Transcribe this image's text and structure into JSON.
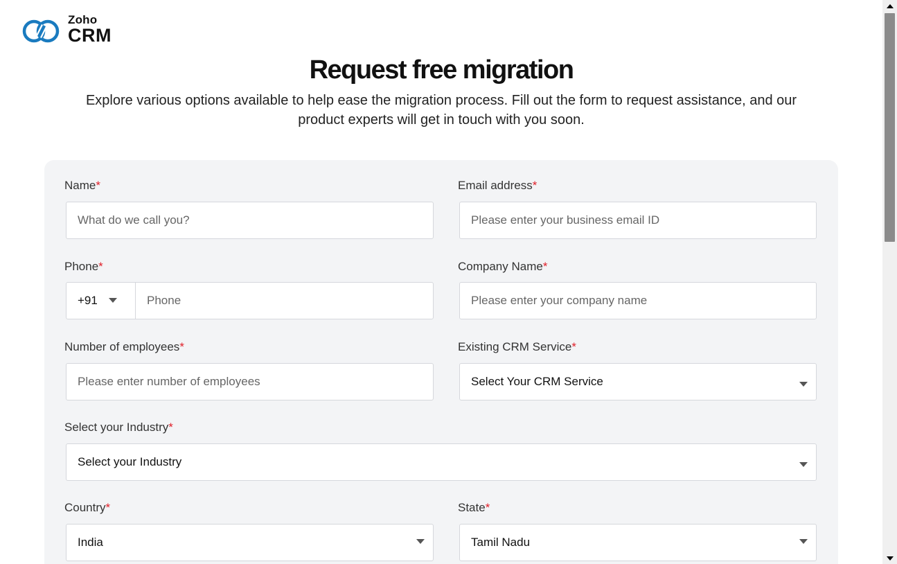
{
  "brand": {
    "logo_small": "Zoho",
    "logo_big": "CRM",
    "logo_color": "#1a7bbf"
  },
  "header": {
    "title": "Request free migration",
    "subtitle": "Explore various options available to help ease the migration process. Fill out the form to request assistance, and our product experts will get in touch with you soon."
  },
  "form": {
    "required_marker": "*",
    "required_color": "#e0202a",
    "name": {
      "label": "Name",
      "placeholder": "What do we call you?",
      "value": ""
    },
    "email": {
      "label": "Email address",
      "placeholder": "Please enter your business email ID",
      "value": ""
    },
    "phone": {
      "label": "Phone",
      "country_code": "+91",
      "placeholder": "Phone",
      "value": ""
    },
    "company": {
      "label": "Company Name",
      "placeholder": "Please enter your company name",
      "value": ""
    },
    "employees": {
      "label": "Number of employees",
      "placeholder": "Please enter number of employees",
      "value": ""
    },
    "crm_service": {
      "label": "Existing CRM Service",
      "selected": "Select Your CRM Service"
    },
    "industry": {
      "label": "Select your Industry",
      "selected": "Select your Industry"
    },
    "country": {
      "label": "Country",
      "selected": "India"
    },
    "state": {
      "label": "State",
      "selected": "Tamil Nadu"
    }
  }
}
